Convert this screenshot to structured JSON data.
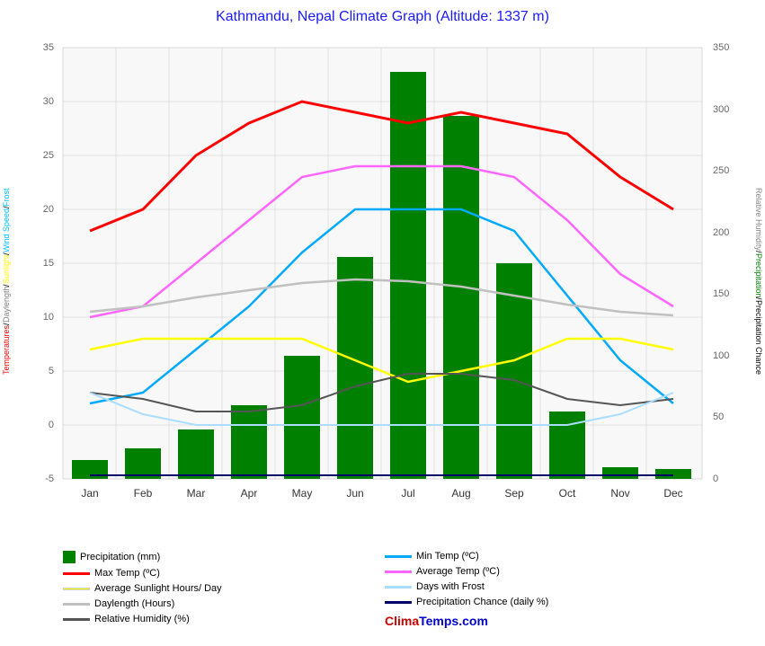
{
  "title": "Kathmandu, Nepal Climate Graph (Altitude: 1337 m)",
  "months": [
    "Jan",
    "Feb",
    "Mar",
    "Apr",
    "May",
    "Jun",
    "Jul",
    "Aug",
    "Sep",
    "Oct",
    "Nov",
    "Dec"
  ],
  "precipitation": [
    15,
    25,
    40,
    60,
    100,
    180,
    330,
    295,
    175,
    55,
    10,
    8
  ],
  "minTemp": [
    2,
    3,
    7,
    11,
    16,
    20,
    20,
    20,
    18,
    12,
    6,
    2
  ],
  "maxTemp": [
    18,
    20,
    25,
    28,
    30,
    29,
    28,
    29,
    28,
    27,
    23,
    20
  ],
  "avgTemp": [
    10,
    11,
    15,
    19,
    23,
    24,
    24,
    24,
    23,
    19,
    14,
    11
  ],
  "sunlight": [
    7,
    8,
    8,
    8,
    8,
    6,
    4,
    5,
    6,
    8,
    8,
    7
  ],
  "daysWithFrost": [
    3,
    1,
    0,
    0,
    0,
    0,
    0,
    0,
    0,
    0,
    1,
    3
  ],
  "daylength": [
    10.5,
    11,
    11.8,
    12.5,
    13.2,
    13.5,
    13.3,
    12.8,
    12,
    11.2,
    10.5,
    10.2
  ],
  "precipChance": [
    3,
    3,
    2,
    2,
    3,
    3,
    3,
    3,
    3,
    3,
    2,
    3
  ],
  "relativeHumidity": [
    70,
    65,
    55,
    55,
    60,
    75,
    85,
    85,
    80,
    65,
    60,
    65
  ],
  "legend": {
    "precipitation_label": "Precipitation (mm)",
    "min_temp_label": "Min Temp (ºC)",
    "max_temp_label": "Max Temp (ºC)",
    "avg_temp_label": "Average Temp (ºC)",
    "sunlight_label": "Average Sunlight Hours/ Day",
    "frost_label": "Days with Frost",
    "daylength_label": "Daylength (Hours)",
    "precip_chance_label": "Precipitation Chance (daily %)",
    "humidity_label": "Relative Humidity (%)"
  },
  "branding": {
    "part1": "Clima",
    "part2": "Temps.com"
  },
  "left_axis_label": "Temperatures/ Daylength/ Sunlight/ Wind Speed/ Frost",
  "right_axis_label": "Relative Humidity/ Precipitation/ Precipitation Chance"
}
